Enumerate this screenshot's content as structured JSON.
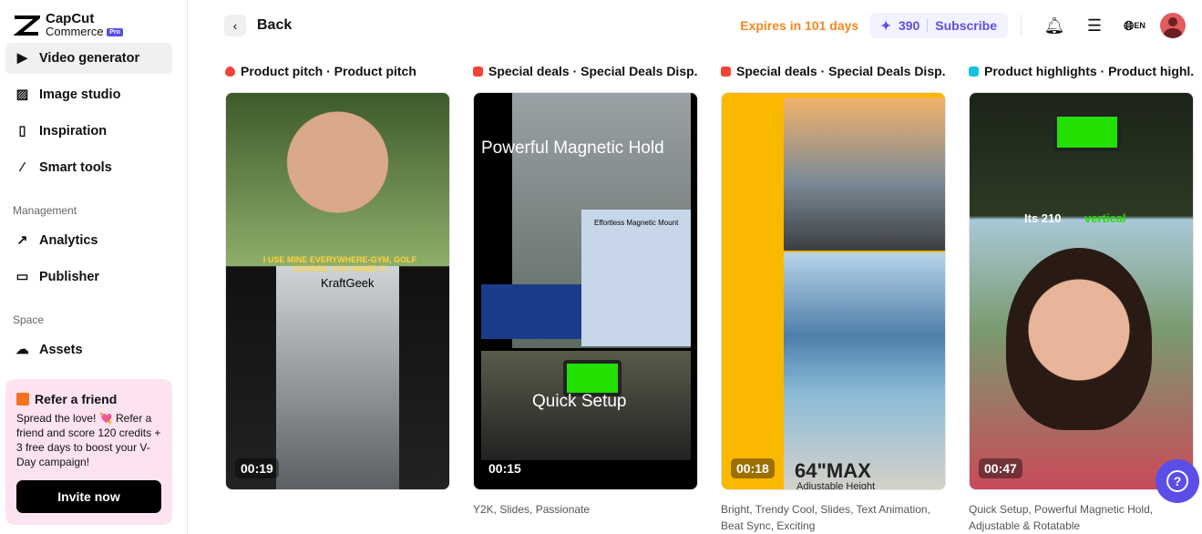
{
  "sidebar": {
    "logo": {
      "line1": "CapCut",
      "line2": "Commerce",
      "badge": "Pro"
    },
    "items": [
      {
        "label": "Video generator",
        "icon": "video-sparkle-icon",
        "active": true
      },
      {
        "label": "Image studio",
        "icon": "image-sparkle-icon"
      },
      {
        "label": "Inspiration",
        "icon": "phone-icon"
      },
      {
        "label": "Smart tools",
        "icon": "magic-wand-icon"
      }
    ],
    "management_label": "Management",
    "management": [
      {
        "label": "Analytics",
        "icon": "chart-icon"
      },
      {
        "label": "Publisher",
        "icon": "calendar-icon"
      }
    ],
    "space_label": "Space",
    "space": [
      {
        "label": "Assets",
        "icon": "cloud-icon"
      }
    ],
    "refer": {
      "title": "Refer a friend",
      "text": "Spread the love! 💘 Refer a friend and score 120 credits + 3 free days to boost your V-Day campaign!",
      "button": "Invite now"
    }
  },
  "header": {
    "back": "Back",
    "expires": "Expires in 101 days",
    "credits": "390",
    "subscribe": "Subscribe",
    "lang": "EN"
  },
  "cards": [
    {
      "title": "Product pitch · Product pitch",
      "badge_color": "#f04438",
      "duration": "00:19",
      "tags": "",
      "overlay": [
        "I USE MINE EVERYWHERE-GYM, GOLF COURSE, YOU NAME IT.",
        "KraftGeek"
      ]
    },
    {
      "title": "Special deals · Special Deals Disp...",
      "badge_color": "#f04438",
      "duration": "00:15",
      "tags": "Y2K, Slides, Passionate",
      "overlay": [
        "Powerful Magnetic Hold",
        "Quick Setup",
        "Effortless Magnetic Mount"
      ]
    },
    {
      "title": "Special deals · Special Deals Disp...",
      "badge_color": "#f04438",
      "duration": "00:18",
      "tags": "Bright, Trendy Cool, Slides, Text Animation, Beat Sync, Exciting",
      "overlay": [
        "64\"MAX",
        "Adjustable Height"
      ]
    },
    {
      "title": "Product highlights · Product highl...",
      "badge_color": "#14c1e0",
      "duration": "00:47",
      "tags": "Quick Setup, Powerful Magnetic Hold, Adjustable & Rotatable",
      "overlay": [
        "Its 210",
        "vertical"
      ]
    }
  ]
}
